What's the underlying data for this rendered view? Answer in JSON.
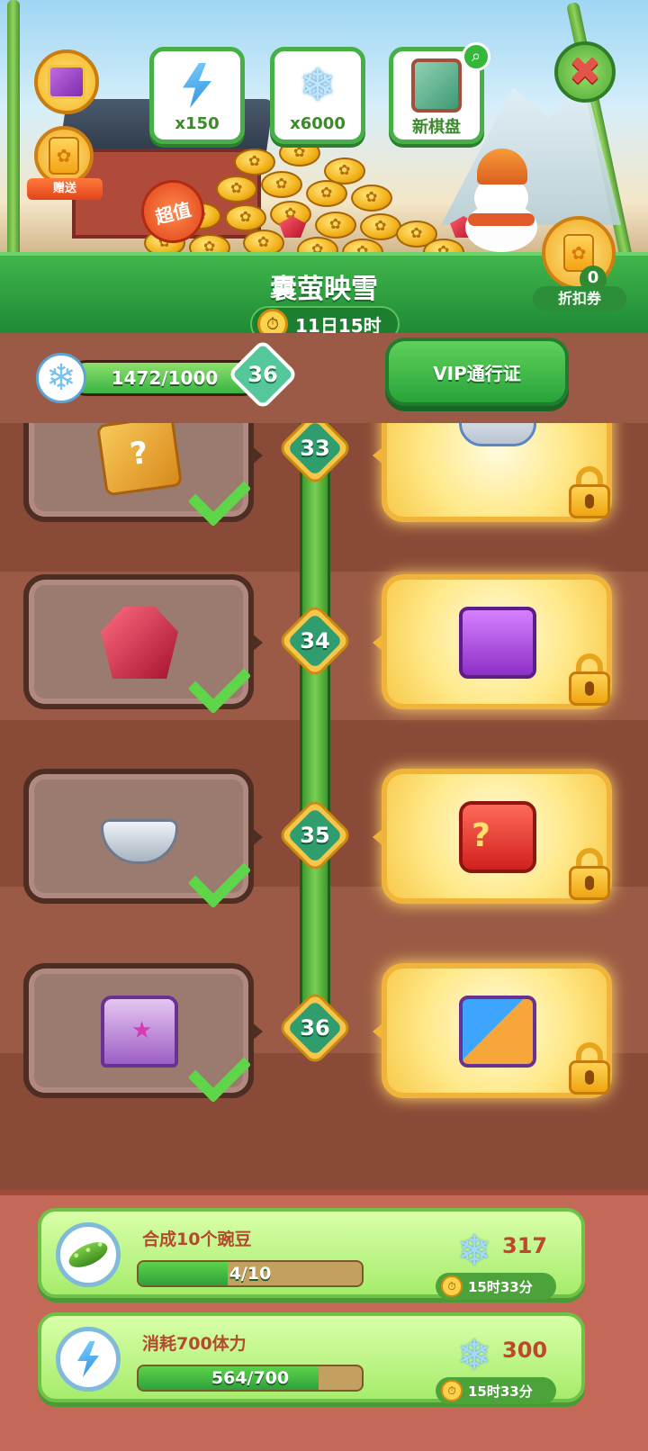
{
  "header": {
    "gift_label": "赠送",
    "rewards": [
      {
        "icon": "energy-bolt-icon",
        "label": "x150"
      },
      {
        "icon": "snowflake-icon",
        "label": "x6000"
      },
      {
        "icon": "chessboard-icon",
        "label": "新棋盘"
      }
    ],
    "super_value_badge": "超值",
    "discount": {
      "count": "0",
      "label": "折扣券"
    }
  },
  "event": {
    "title": "囊萤映雪",
    "timer": "11日15时",
    "progress_text": "1472/1000",
    "progress_fraction": 1.0,
    "current_level": "36",
    "vip_button": "VIP通行证"
  },
  "levels": [
    {
      "level": "33",
      "free_item": "mystery-box",
      "vip_item": "shell-bowl",
      "claimed": true,
      "vip_locked": true
    },
    {
      "level": "34",
      "free_item": "ruby-gem",
      "vip_item": "purple-chest",
      "claimed": true,
      "vip_locked": true
    },
    {
      "level": "35",
      "free_item": "silver-bowl",
      "vip_item": "red-mystery-chest",
      "claimed": true,
      "vip_locked": true
    },
    {
      "level": "36",
      "free_item": "purple-star-chest",
      "vip_item": "multi-chest-bundle",
      "claimed": true,
      "vip_locked": true
    }
  ],
  "tasks": [
    {
      "icon": "pea-icon",
      "desc": "合成10个豌豆",
      "progress_text": "4/10",
      "progress_fraction": 0.4,
      "reward": "317",
      "timer": "15时33分"
    },
    {
      "icon": "energy-bolt-icon",
      "desc": "消耗700体力",
      "progress_text": "564/700",
      "progress_fraction": 0.8057,
      "reward": "300",
      "timer": "15时33分"
    }
  ],
  "colors": {
    "accent_green": "#2ea23a",
    "title_band": "#1f8a36",
    "task_text": "#b44a2e",
    "vip_gold": "#f0b43a"
  }
}
